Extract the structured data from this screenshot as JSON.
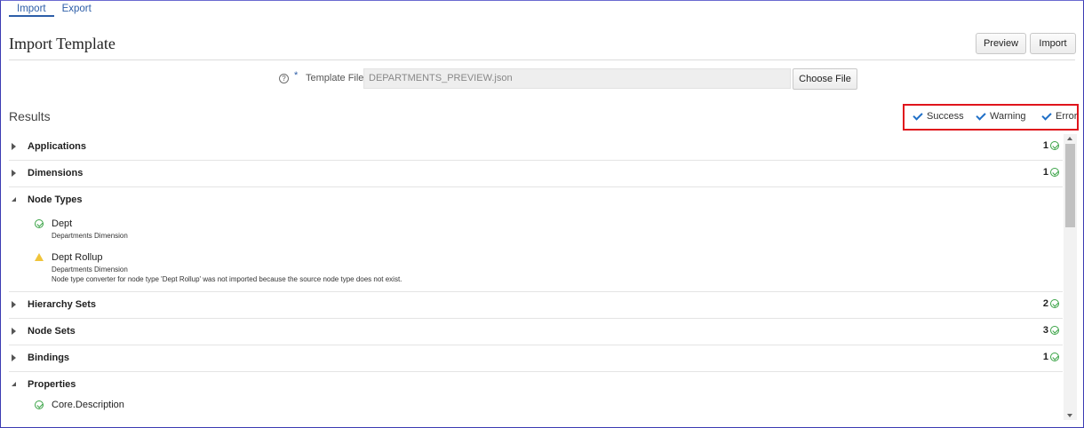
{
  "tabs": [
    {
      "label": "Import",
      "active": true
    },
    {
      "label": "Export",
      "active": false
    }
  ],
  "header": {
    "title": "Import Template",
    "preview_label": "Preview",
    "import_label": "Import"
  },
  "template_file": {
    "help_icon": "help-circle-icon",
    "required_marker": "*",
    "label": "Template File",
    "value": "DEPARTMENTS_PREVIEW.json",
    "choose_label": "Choose File"
  },
  "results": {
    "title": "Results",
    "filters": [
      {
        "label": "Success",
        "checked": true
      },
      {
        "label": "Warning",
        "checked": true
      },
      {
        "label": "Error",
        "checked": true
      }
    ],
    "sections": [
      {
        "label": "Applications",
        "count": "1",
        "expanded": false
      },
      {
        "label": "Dimensions",
        "count": "1",
        "expanded": false
      },
      {
        "label": "Node Types",
        "count": "",
        "expanded": true,
        "items": [
          {
            "status": "success",
            "name": "Dept",
            "lines": [
              "Departments Dimension"
            ]
          },
          {
            "status": "warning",
            "name": "Dept Rollup",
            "lines": [
              "Departments Dimension",
              "Node type converter for node type 'Dept Rollup' was not imported because the source node type does not exist."
            ]
          }
        ]
      },
      {
        "label": "Hierarchy Sets",
        "count": "2",
        "expanded": false
      },
      {
        "label": "Node Sets",
        "count": "3",
        "expanded": false
      },
      {
        "label": "Bindings",
        "count": "1",
        "expanded": false
      },
      {
        "label": "Properties",
        "count": "",
        "expanded": true,
        "items": [
          {
            "status": "success",
            "name": "Core.Description",
            "lines": []
          }
        ]
      }
    ]
  },
  "colors": {
    "accent": "#2d5ea8",
    "success": "#3aa346",
    "warning": "#f0c43a",
    "highlight": "#e0141c"
  }
}
